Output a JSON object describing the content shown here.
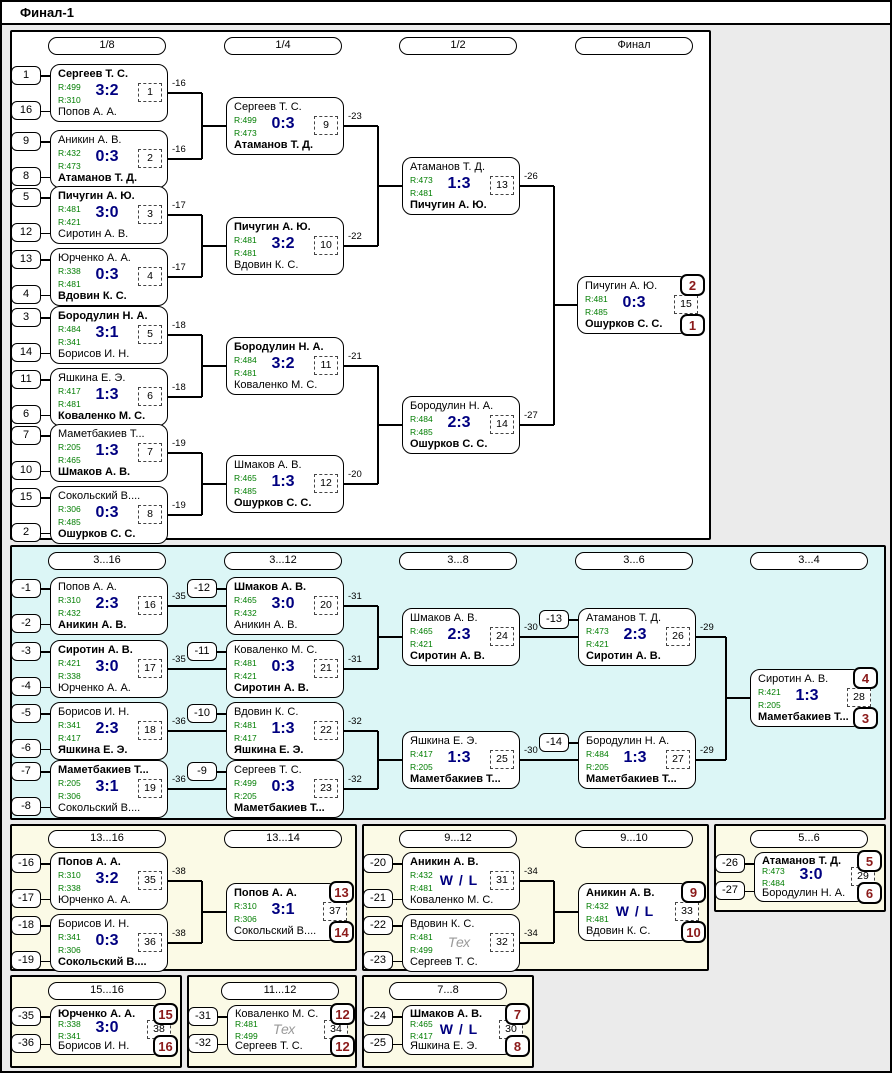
{
  "title": "Финал-1",
  "colors": {
    "rating_green": "#007d00",
    "score_navy": "#000080",
    "place_dark_red": "#8b1a1a",
    "section_main_bg": "#ffffff",
    "section_consolation_bg": "#dcf6f6",
    "section_placement_bg": "#fbfae6",
    "page_bg": "#ebebeb"
  },
  "sections": {
    "main": {
      "headers": [
        "1/8",
        "1/4",
        "1/2",
        "Финал"
      ]
    },
    "consolation": {
      "headers": [
        "3...16",
        "3...12",
        "3...8",
        "3...6",
        "3...4"
      ]
    },
    "p13_16": {
      "headers": [
        "13...16",
        "13...14"
      ]
    },
    "p9_12": {
      "headers": [
        "9...12",
        "9...10"
      ]
    },
    "p5_6": {
      "headers": [
        "5...6"
      ]
    },
    "p15_16": {
      "headers": [
        "15...16"
      ]
    },
    "p11_12": {
      "headers": [
        "11...12"
      ]
    },
    "p7_8": {
      "headers": [
        "7...8"
      ]
    }
  },
  "matches": {
    "m1": {
      "num": "1",
      "conn": "-16",
      "seeds": {
        "t": "1",
        "b": "16"
      },
      "top": {
        "name": "Сергеев Т. С.",
        "r": "R:499",
        "winner": true
      },
      "bottom": {
        "name": "Попов А. А.",
        "r": "R:310"
      },
      "score": "3:2"
    },
    "m2": {
      "num": "2",
      "conn": "-16",
      "seeds": {
        "t": "9",
        "b": "8"
      },
      "top": {
        "name": "Аникин А. В.",
        "r": "R:432"
      },
      "bottom": {
        "name": "Атаманов Т. Д.",
        "r": "R:473",
        "winner": true
      },
      "score": "0:3"
    },
    "m3": {
      "num": "3",
      "conn": "-17",
      "seeds": {
        "t": "5",
        "b": "12"
      },
      "top": {
        "name": "Пичугин А. Ю.",
        "r": "R:481",
        "winner": true
      },
      "bottom": {
        "name": "Сиротин А. В.",
        "r": "R:421"
      },
      "score": "3:0"
    },
    "m4": {
      "num": "4",
      "conn": "-17",
      "seeds": {
        "t": "13",
        "b": "4"
      },
      "top": {
        "name": "Юрченко А. А.",
        "r": "R:338"
      },
      "bottom": {
        "name": "Вдовин К. С.",
        "r": "R:481",
        "winner": true
      },
      "score": "0:3"
    },
    "m5": {
      "num": "5",
      "conn": "-18",
      "seeds": {
        "t": "3",
        "b": "14"
      },
      "top": {
        "name": "Бородулин Н. А.",
        "r": "R:484",
        "winner": true
      },
      "bottom": {
        "name": "Борисов И. Н.",
        "r": "R:341"
      },
      "score": "3:1"
    },
    "m6": {
      "num": "6",
      "conn": "-18",
      "seeds": {
        "t": "11",
        "b": "6"
      },
      "top": {
        "name": "Яшкина Е. Э.",
        "r": "R:417"
      },
      "bottom": {
        "name": "Коваленко М. С.",
        "r": "R:481",
        "winner": true
      },
      "score": "1:3"
    },
    "m7": {
      "num": "7",
      "conn": "-19",
      "seeds": {
        "t": "7",
        "b": "10"
      },
      "top": {
        "name": "Маметбакиев Т...",
        "r": "R:205"
      },
      "bottom": {
        "name": "Шмаков А. В.",
        "r": "R:465",
        "winner": true
      },
      "score": "1:3"
    },
    "m8": {
      "num": "8",
      "conn": "-19",
      "seeds": {
        "t": "15",
        "b": "2"
      },
      "top": {
        "name": "Сокольский В....",
        "r": "R:306"
      },
      "bottom": {
        "name": "Ошурков С. С.",
        "r": "R:485",
        "winner": true
      },
      "score": "0:3"
    },
    "m9": {
      "num": "9",
      "conn": "-23",
      "top": {
        "name": "Сергеев Т. С.",
        "r": "R:499"
      },
      "bottom": {
        "name": "Атаманов Т. Д.",
        "r": "R:473",
        "winner": true
      },
      "score": "0:3"
    },
    "m10": {
      "num": "10",
      "conn": "-22",
      "top": {
        "name": "Пичугин А. Ю.",
        "r": "R:481",
        "winner": true
      },
      "bottom": {
        "name": "Вдовин К. С.",
        "r": "R:481"
      },
      "score": "3:2"
    },
    "m11": {
      "num": "11",
      "conn": "-21",
      "top": {
        "name": "Бородулин Н. А.",
        "r": "R:484",
        "winner": true
      },
      "bottom": {
        "name": "Коваленко М. С.",
        "r": "R:481"
      },
      "score": "3:2"
    },
    "m12": {
      "num": "12",
      "conn": "-20",
      "top": {
        "name": "Шмаков А. В.",
        "r": "R:465"
      },
      "bottom": {
        "name": "Ошурков С. С.",
        "r": "R:485",
        "winner": true
      },
      "score": "1:3"
    },
    "m13": {
      "num": "13",
      "conn": "-26",
      "top": {
        "name": "Атаманов Т. Д.",
        "r": "R:473"
      },
      "bottom": {
        "name": "Пичугин А. Ю.",
        "r": "R:481",
        "winner": true
      },
      "score": "1:3"
    },
    "m14": {
      "num": "14",
      "conn": "-27",
      "top": {
        "name": "Бородулин Н. А.",
        "r": "R:484"
      },
      "bottom": {
        "name": "Ошурков С. С.",
        "r": "R:485",
        "winner": true
      },
      "score": "2:3"
    },
    "m15": {
      "num": "15",
      "places": {
        "t": "2",
        "b": "1"
      },
      "top": {
        "name": "Пичугин А. Ю.",
        "r": "R:481"
      },
      "bottom": {
        "name": "Ошурков С. С.",
        "r": "R:485",
        "winner": true
      },
      "score": "0:3"
    },
    "m16": {
      "num": "16",
      "conn": "-35",
      "seeds": {
        "t": "-1",
        "b": "-2"
      },
      "top": {
        "name": "Попов А. А.",
        "r": "R:310"
      },
      "bottom": {
        "name": "Аникин А. В.",
        "r": "R:432",
        "winner": true
      },
      "score": "2:3"
    },
    "m17": {
      "num": "17",
      "conn": "-35",
      "seeds": {
        "t": "-3",
        "b": "-4"
      },
      "top": {
        "name": "Сиротин А. В.",
        "r": "R:421",
        "winner": true
      },
      "bottom": {
        "name": "Юрченко А. А.",
        "r": "R:338"
      },
      "score": "3:0"
    },
    "m18": {
      "num": "18",
      "conn": "-36",
      "seeds": {
        "t": "-5",
        "b": "-6"
      },
      "top": {
        "name": "Борисов И. Н.",
        "r": "R:341"
      },
      "bottom": {
        "name": "Яшкина Е. Э.",
        "r": "R:417",
        "winner": true
      },
      "score": "2:3"
    },
    "m19": {
      "num": "19",
      "conn": "-36",
      "seeds": {
        "t": "-7",
        "b": "-8"
      },
      "top": {
        "name": "Маметбакиев Т...",
        "r": "R:205",
        "winner": true
      },
      "bottom": {
        "name": "Сокольский В....",
        "r": "R:306"
      },
      "score": "3:1"
    },
    "m20": {
      "num": "20",
      "conn": "-31",
      "seeds": {
        "t": "-12"
      },
      "top": {
        "name": "Шмаков А. В.",
        "r": "R:465",
        "winner": true
      },
      "bottom": {
        "name": "Аникин А. В.",
        "r": "R:432"
      },
      "score": "3:0"
    },
    "m21": {
      "num": "21",
      "conn": "-31",
      "seeds": {
        "t": "-11"
      },
      "top": {
        "name": "Коваленко М. С.",
        "r": "R:481"
      },
      "bottom": {
        "name": "Сиротин А. В.",
        "r": "R:421",
        "winner": true
      },
      "score": "0:3"
    },
    "m22": {
      "num": "22",
      "conn": "-32",
      "seeds": {
        "t": "-10"
      },
      "top": {
        "name": "Вдовин К. С.",
        "r": "R:481"
      },
      "bottom": {
        "name": "Яшкина Е. Э.",
        "r": "R:417",
        "winner": true
      },
      "score": "1:3"
    },
    "m23": {
      "num": "23",
      "conn": "-32",
      "seeds": {
        "t": "-9"
      },
      "top": {
        "name": "Сергеев Т. С.",
        "r": "R:499"
      },
      "bottom": {
        "name": "Маметбакиев Т...",
        "r": "R:205",
        "winner": true
      },
      "score": "0:3"
    },
    "m24": {
      "num": "24",
      "conn": "-30",
      "top": {
        "name": "Шмаков А. В.",
        "r": "R:465"
      },
      "bottom": {
        "name": "Сиротин А. В.",
        "r": "R:421",
        "winner": true
      },
      "score": "2:3"
    },
    "m25": {
      "num": "25",
      "conn": "-30",
      "top": {
        "name": "Яшкина Е. Э.",
        "r": "R:417"
      },
      "bottom": {
        "name": "Маметбакиев Т...",
        "r": "R:205",
        "winner": true
      },
      "score": "1:3"
    },
    "m26": {
      "num": "26",
      "conn": "-29",
      "seeds": {
        "t": "-13"
      },
      "top": {
        "name": "Атаманов Т. Д.",
        "r": "R:473"
      },
      "bottom": {
        "name": "Сиротин А. В.",
        "r": "R:421",
        "winner": true
      },
      "score": "2:3"
    },
    "m27": {
      "num": "27",
      "conn": "-29",
      "seeds": {
        "t": "-14"
      },
      "top": {
        "name": "Бородулин Н. А.",
        "r": "R:484"
      },
      "bottom": {
        "name": "Маметбакиев Т...",
        "r": "R:205",
        "winner": true
      },
      "score": "1:3"
    },
    "m28": {
      "num": "28",
      "places": {
        "t": "4",
        "b": "3"
      },
      "top": {
        "name": "Сиротин А. В.",
        "r": "R:421"
      },
      "bottom": {
        "name": "Маметбакиев Т...",
        "r": "R:205",
        "winner": true
      },
      "score": "1:3"
    },
    "m29": {
      "num": "29",
      "places": {
        "t": "5",
        "b": "6"
      },
      "seeds": {
        "t": "-26",
        "b": "-27"
      },
      "top": {
        "name": "Атаманов Т. Д.",
        "r": "R:473",
        "winner": true
      },
      "bottom": {
        "name": "Бородулин Н. А.",
        "r": "R:484"
      },
      "score": "3:0"
    },
    "m30": {
      "num": "30",
      "places": {
        "t": "7",
        "b": "8"
      },
      "seeds": {
        "t": "-24",
        "b": "-25"
      },
      "top": {
        "name": "Шмаков А. В.",
        "r": "R:465",
        "winner": true
      },
      "bottom": {
        "name": "Яшкина Е. Э.",
        "r": "R:417"
      },
      "score": "W / L",
      "style": "wl"
    },
    "m31": {
      "num": "31",
      "conn": "-34",
      "seeds": {
        "t": "-20",
        "b": "-21"
      },
      "top": {
        "name": "Аникин А. В.",
        "r": "R:432",
        "winner": true
      },
      "bottom": {
        "name": "Коваленко М. С.",
        "r": "R:481"
      },
      "score": "W / L",
      "style": "wl"
    },
    "m32": {
      "num": "32",
      "conn": "-34",
      "seeds": {
        "t": "-22",
        "b": "-23"
      },
      "top": {
        "name": "Вдовин К. С.",
        "r": "R:481"
      },
      "bottom": {
        "name": "Сергеев Т. С.",
        "r": "R:499"
      },
      "score": "Тех",
      "style": "tech"
    },
    "m33": {
      "num": "33",
      "places": {
        "t": "9",
        "b": "10"
      },
      "top": {
        "name": "Аникин А. В.",
        "r": "R:432",
        "winner": true
      },
      "bottom": {
        "name": "Вдовин К. С.",
        "r": "R:481"
      },
      "score": "W / L",
      "style": "wl"
    },
    "m34": {
      "num": "34",
      "places": {
        "t": "12",
        "b": "12"
      },
      "seeds": {
        "t": "-31",
        "b": "-32"
      },
      "top": {
        "name": "Коваленко М. С.",
        "r": "R:481"
      },
      "bottom": {
        "name": "Сергеев Т. С.",
        "r": "R:499"
      },
      "score": "Тех",
      "style": "tech"
    },
    "m35": {
      "num": "35",
      "conn": "-38",
      "seeds": {
        "t": "-16",
        "b": "-17"
      },
      "top": {
        "name": "Попов А. А.",
        "r": "R:310",
        "winner": true
      },
      "bottom": {
        "name": "Юрченко А. А.",
        "r": "R:338"
      },
      "score": "3:2"
    },
    "m36": {
      "num": "36",
      "conn": "-38",
      "seeds": {
        "t": "-18",
        "b": "-19"
      },
      "top": {
        "name": "Борисов И. Н.",
        "r": "R:341"
      },
      "bottom": {
        "name": "Сокольский В....",
        "r": "R:306",
        "winner": true
      },
      "score": "0:3"
    },
    "m37": {
      "num": "37",
      "places": {
        "t": "13",
        "b": "14"
      },
      "top": {
        "name": "Попов А. А.",
        "r": "R:310",
        "winner": true
      },
      "bottom": {
        "name": "Сокольский В....",
        "r": "R:306"
      },
      "score": "3:1"
    },
    "m38": {
      "num": "38",
      "places": {
        "t": "15",
        "b": "16"
      },
      "seeds": {
        "t": "-35",
        "b": "-36"
      },
      "top": {
        "name": "Юрченко А. А.",
        "r": "R:338",
        "winner": true
      },
      "bottom": {
        "name": "Борисов И. Н.",
        "r": "R:341"
      },
      "score": "3:0"
    }
  }
}
